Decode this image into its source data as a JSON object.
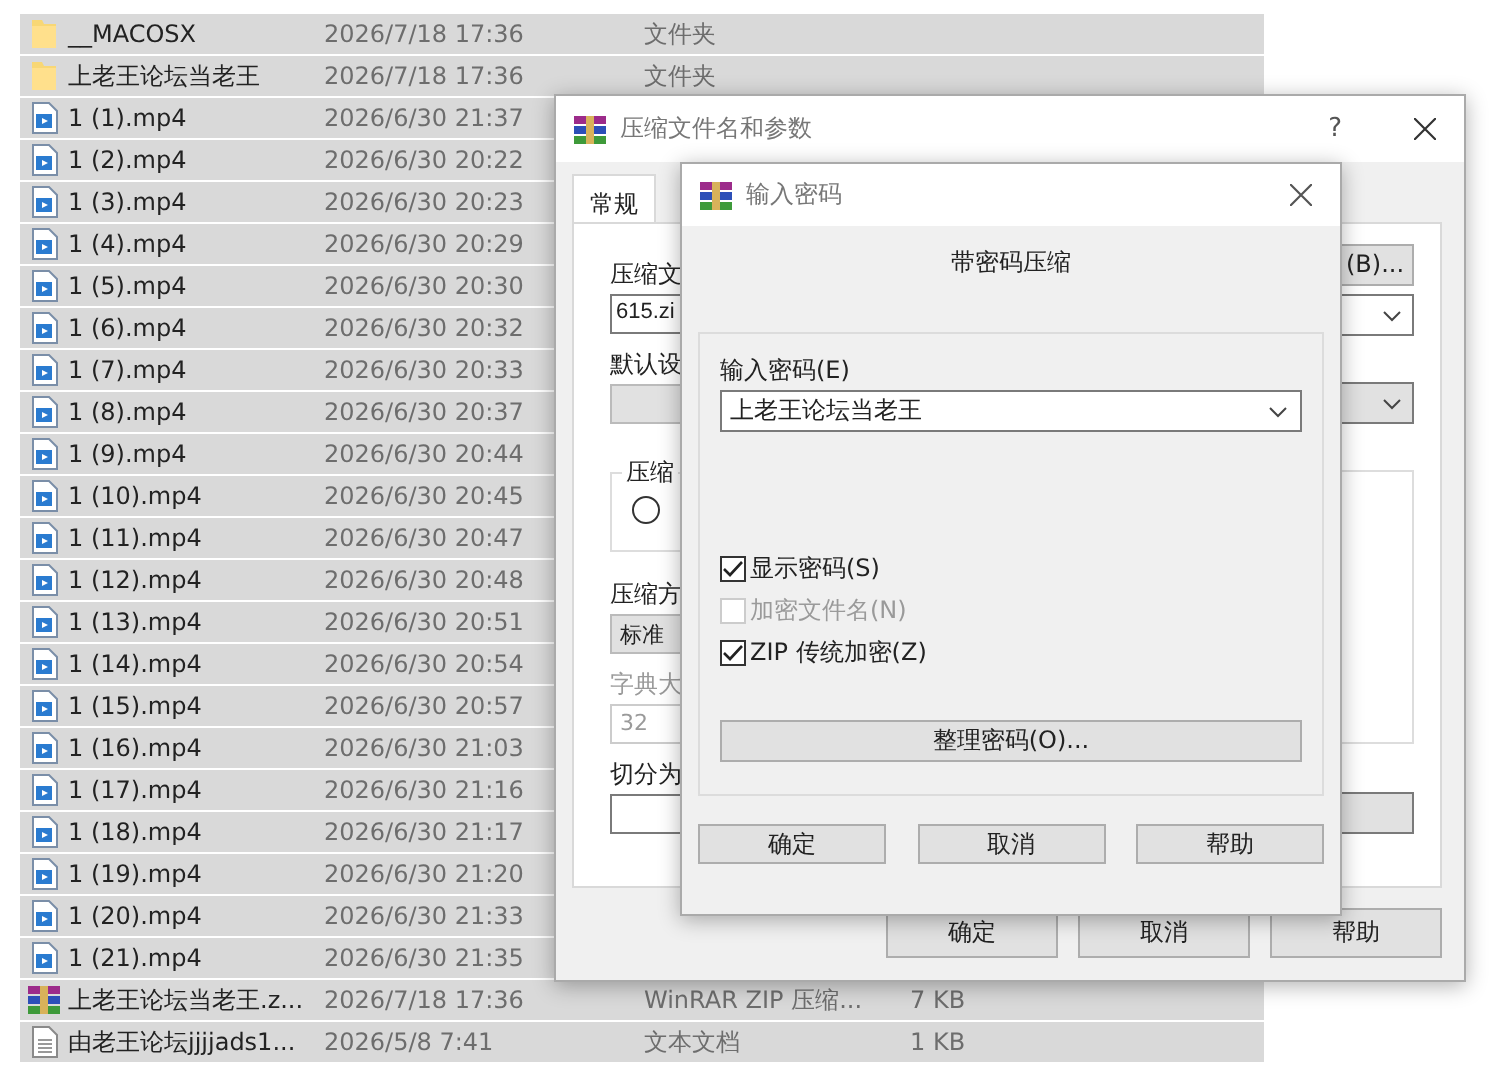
{
  "files": [
    {
      "kind": "folder",
      "name": "__MACOSX",
      "modified": "2026/7/18 17:36",
      "type": "文件夹",
      "selected": true
    },
    {
      "kind": "folder",
      "name": "上老王论坛当老王",
      "modified": "2026/7/18 17:36",
      "type": "文件夹",
      "selected": true
    },
    {
      "kind": "video",
      "name": "1 (1).mp4",
      "modified": "2026/6/30 21:37",
      "selected": true
    },
    {
      "kind": "video",
      "name": "1 (2).mp4",
      "modified": "2026/6/30 20:22",
      "selected": true
    },
    {
      "kind": "video",
      "name": "1 (3).mp4",
      "modified": "2026/6/30 20:23",
      "selected": true
    },
    {
      "kind": "video",
      "name": "1 (4).mp4",
      "modified": "2026/6/30 20:29",
      "selected": true
    },
    {
      "kind": "video",
      "name": "1 (5).mp4",
      "modified": "2026/6/30 20:30",
      "selected": true
    },
    {
      "kind": "video",
      "name": "1 (6).mp4",
      "modified": "2026/6/30 20:32",
      "selected": true
    },
    {
      "kind": "video",
      "name": "1 (7).mp4",
      "modified": "2026/6/30 20:33",
      "selected": true
    },
    {
      "kind": "video",
      "name": "1 (8).mp4",
      "modified": "2026/6/30 20:37",
      "selected": true
    },
    {
      "kind": "video",
      "name": "1 (9).mp4",
      "modified": "2026/6/30 20:44",
      "selected": true
    },
    {
      "kind": "video",
      "name": "1 (10).mp4",
      "modified": "2026/6/30 20:45",
      "selected": true
    },
    {
      "kind": "video",
      "name": "1 (11).mp4",
      "modified": "2026/6/30 20:47",
      "selected": true
    },
    {
      "kind": "video",
      "name": "1 (12).mp4",
      "modified": "2026/6/30 20:48",
      "selected": true
    },
    {
      "kind": "video",
      "name": "1 (13).mp4",
      "modified": "2026/6/30 20:51",
      "selected": true
    },
    {
      "kind": "video",
      "name": "1 (14).mp4",
      "modified": "2026/6/30 20:54",
      "selected": true
    },
    {
      "kind": "video",
      "name": "1 (15).mp4",
      "modified": "2026/6/30 20:57",
      "selected": true
    },
    {
      "kind": "video",
      "name": "1 (16).mp4",
      "modified": "2026/6/30 21:03",
      "selected": true
    },
    {
      "kind": "video",
      "name": "1 (17).mp4",
      "modified": "2026/6/30 21:16",
      "selected": true
    },
    {
      "kind": "video",
      "name": "1 (18).mp4",
      "modified": "2026/6/30 21:17",
      "selected": true
    },
    {
      "kind": "video",
      "name": "1 (19).mp4",
      "modified": "2026/6/30 21:20",
      "selected": true
    },
    {
      "kind": "video",
      "name": "1 (20).mp4",
      "modified": "2026/6/30 21:33",
      "selected": true
    },
    {
      "kind": "video",
      "name": "1 (21).mp4",
      "modified": "2026/6/30 21:35",
      "selected": true
    },
    {
      "kind": "archive",
      "name": "上老王论坛当老王.z...",
      "modified": "2026/7/18 17:36",
      "type": "WinRAR ZIP 压缩...",
      "size": "7 KB",
      "selected": true
    },
    {
      "kind": "text",
      "name": "由老王论坛jjjjads1...",
      "modified": "2026/5/8 7:41",
      "type": "文本文档",
      "size": "1 KB",
      "selected": true
    }
  ],
  "archive_dialog": {
    "title": "压缩文件名和参数",
    "help": "?",
    "tabs": [
      {
        "label": "常规",
        "selected": true
      }
    ],
    "archive_name_label": "压缩文",
    "browse_button": "(B)...",
    "archive_name_value": "615.zi",
    "profile_label": "默认设",
    "format_group_label": "压缩",
    "format_radio": {
      "selected": false
    },
    "method_label": "压缩方",
    "method_value": "标准",
    "dictionary_label": "字典大",
    "dictionary_value": "32",
    "split_label": "切分为",
    "buttons": [
      "确定",
      "取消",
      "帮助"
    ]
  },
  "password_dialog": {
    "title": "输入密码",
    "heading": "带密码压缩",
    "password_label": "输入密码(E)",
    "password_value": "上老王论坛当老王",
    "options": [
      {
        "label": "显示密码(S)",
        "checked": true,
        "disabled": false
      },
      {
        "label": "加密文件名(N)",
        "checked": false,
        "disabled": true
      },
      {
        "label": "ZIP 传统加密(Z)",
        "checked": true,
        "disabled": false
      }
    ],
    "organize_button": "整理密码(O)...",
    "buttons": [
      "确定",
      "取消",
      "帮助"
    ]
  }
}
